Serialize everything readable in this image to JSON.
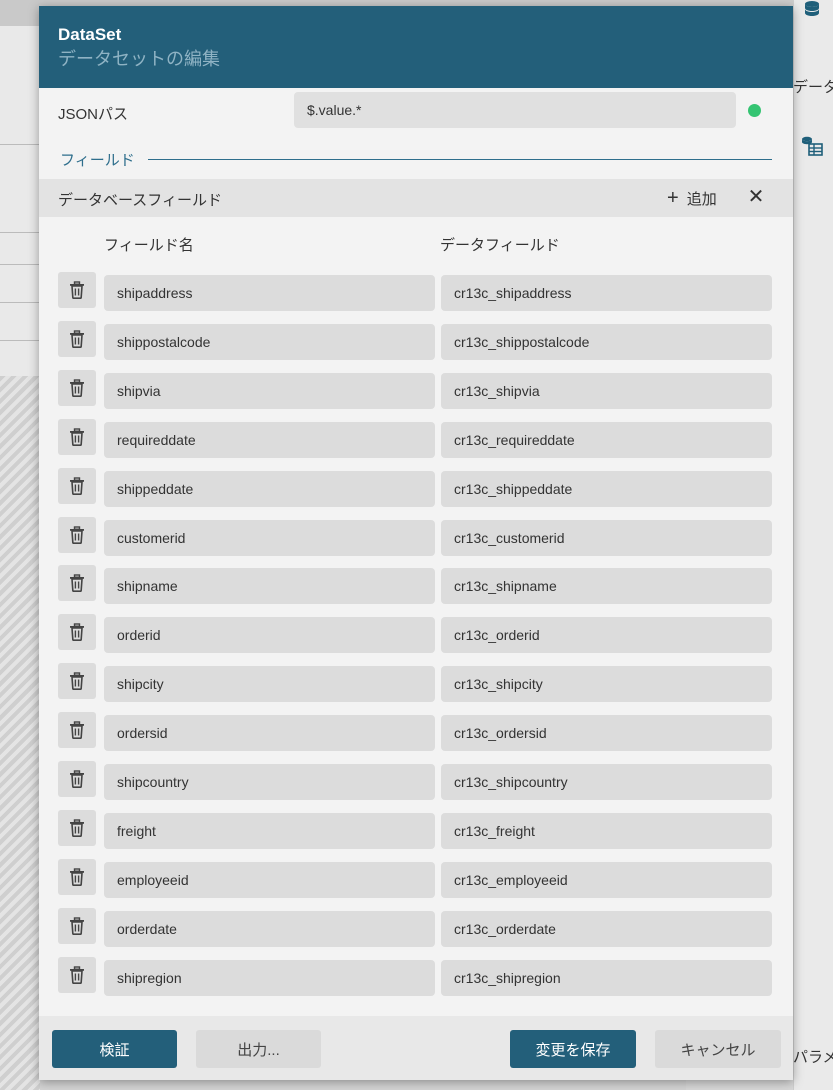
{
  "side": {
    "top_label": "データ",
    "bottom_label": "パラメ"
  },
  "dialog": {
    "title": "DataSet",
    "subtitle": "データセットの編集",
    "json_path_label": "JSONパス",
    "json_path_value": "$.value.*",
    "section_title": "フィールド",
    "db_fields_title": "データベースフィールド",
    "add_label": "追加",
    "close_glyph": "✕",
    "col_field_name": "フィールド名",
    "col_data_field": "データフィールド",
    "rows": [
      {
        "name": "shipaddress",
        "data": "cr13c_shipaddress"
      },
      {
        "name": "shippostalcode",
        "data": "cr13c_shippostalcode"
      },
      {
        "name": "shipvia",
        "data": "cr13c_shipvia"
      },
      {
        "name": "requireddate",
        "data": "cr13c_requireddate"
      },
      {
        "name": "shippeddate",
        "data": "cr13c_shippeddate"
      },
      {
        "name": "customerid",
        "data": "cr13c_customerid"
      },
      {
        "name": "shipname",
        "data": "cr13c_shipname"
      },
      {
        "name": "orderid",
        "data": "cr13c_orderid"
      },
      {
        "name": "shipcity",
        "data": "cr13c_shipcity"
      },
      {
        "name": "ordersid",
        "data": "cr13c_ordersid"
      },
      {
        "name": "shipcountry",
        "data": "cr13c_shipcountry"
      },
      {
        "name": "freight",
        "data": "cr13c_freight"
      },
      {
        "name": "employeeid",
        "data": "cr13c_employeeid"
      },
      {
        "name": "orderdate",
        "data": "cr13c_orderdate"
      },
      {
        "name": "shipregion",
        "data": "cr13c_shipregion"
      }
    ],
    "footer": {
      "validate": "検証",
      "output": "出力...",
      "save": "変更を保存",
      "cancel": "キャンセル"
    }
  },
  "colors": {
    "header": "#235f7a",
    "status_ok": "#34c472",
    "accent": "#2e6e8c"
  }
}
